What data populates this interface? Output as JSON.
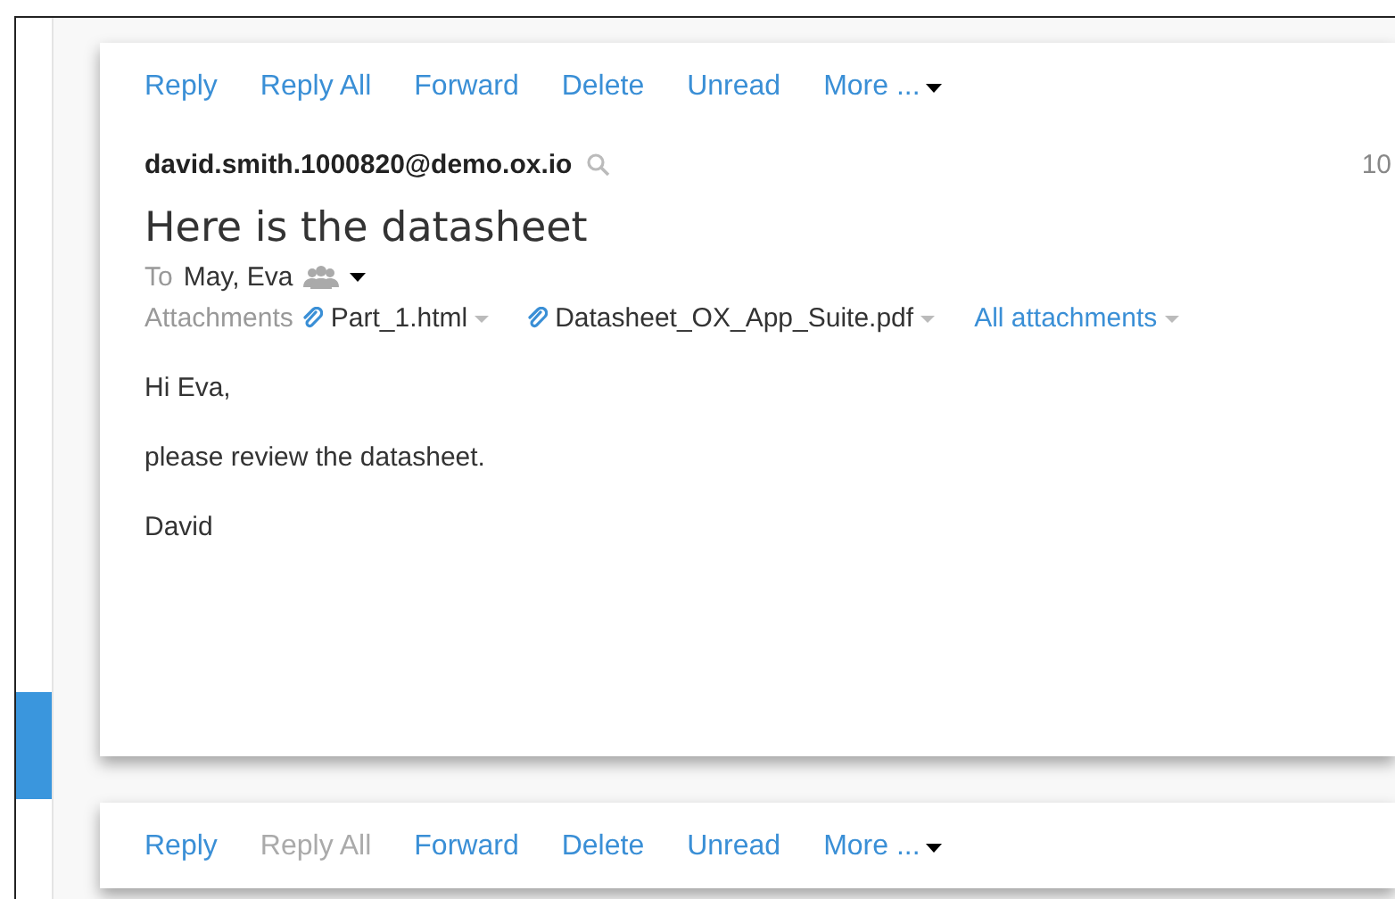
{
  "mails": [
    {
      "toolbar": [
        {
          "label": "Reply",
          "disabled": false,
          "caret": false
        },
        {
          "label": "Reply All",
          "disabled": false,
          "caret": false
        },
        {
          "label": "Forward",
          "disabled": false,
          "caret": false
        },
        {
          "label": "Delete",
          "disabled": false,
          "caret": false
        },
        {
          "label": "Unread",
          "disabled": false,
          "caret": false
        },
        {
          "label": "More ...",
          "disabled": false,
          "caret": true
        }
      ],
      "from": "david.smith.1000820@demo.ox.io",
      "date": "10",
      "subject": "Here is the datasheet",
      "to_label": "To",
      "to": "May, Eva",
      "attachments_label": "Attachments",
      "attachments": [
        "Part_1.html",
        "Datasheet_OX_App_Suite.pdf"
      ],
      "all_attachments": "All attachments",
      "body": [
        "Hi Eva,",
        "please review the datasheet.",
        "David"
      ]
    },
    {
      "toolbar": [
        {
          "label": "Reply",
          "disabled": false,
          "caret": false
        },
        {
          "label": "Reply All",
          "disabled": true,
          "caret": false
        },
        {
          "label": "Forward",
          "disabled": false,
          "caret": false
        },
        {
          "label": "Delete",
          "disabled": false,
          "caret": false
        },
        {
          "label": "Unread",
          "disabled": false,
          "caret": false
        },
        {
          "label": "More ...",
          "disabled": false,
          "caret": true
        }
      ]
    }
  ]
}
